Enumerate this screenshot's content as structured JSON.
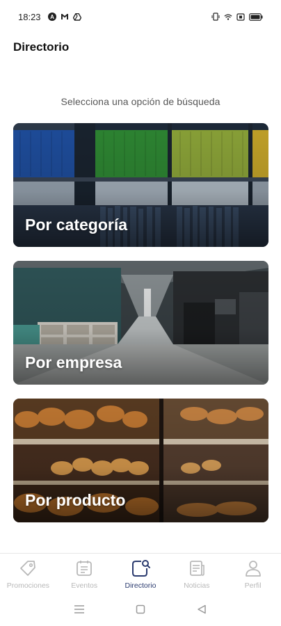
{
  "status_bar": {
    "time": "18:23",
    "left_icons": [
      "a-badge-icon",
      "gmail-icon",
      "drive-icon"
    ],
    "right_icons": [
      "vibrate-icon",
      "wifi-icon",
      "sim-icon",
      "battery-icon"
    ],
    "battery_label": "88"
  },
  "header": {
    "title": "Directorio"
  },
  "main": {
    "subtitle": "Selecciona una opción de búsqueda",
    "cards": [
      {
        "label": "Por categoría",
        "image": "library-shelves-photo"
      },
      {
        "label": "Por empresa",
        "image": "office-interior-photo"
      },
      {
        "label": "Por producto",
        "image": "bakery-display-photo"
      }
    ]
  },
  "bottom_nav": {
    "items": [
      {
        "label": "Promociones",
        "icon": "tag-icon",
        "active": false
      },
      {
        "label": "Eventos",
        "icon": "calendar-icon",
        "active": false
      },
      {
        "label": "Directorio",
        "icon": "directory-search-icon",
        "active": true
      },
      {
        "label": "Noticias",
        "icon": "news-icon",
        "active": false
      },
      {
        "label": "Perfil",
        "icon": "user-icon",
        "active": false
      }
    ],
    "active_color": "#2a3a6e",
    "inactive_color": "#b8b8b8"
  },
  "system_nav": {
    "buttons": [
      "menu-icon",
      "home-icon",
      "back-icon"
    ]
  }
}
